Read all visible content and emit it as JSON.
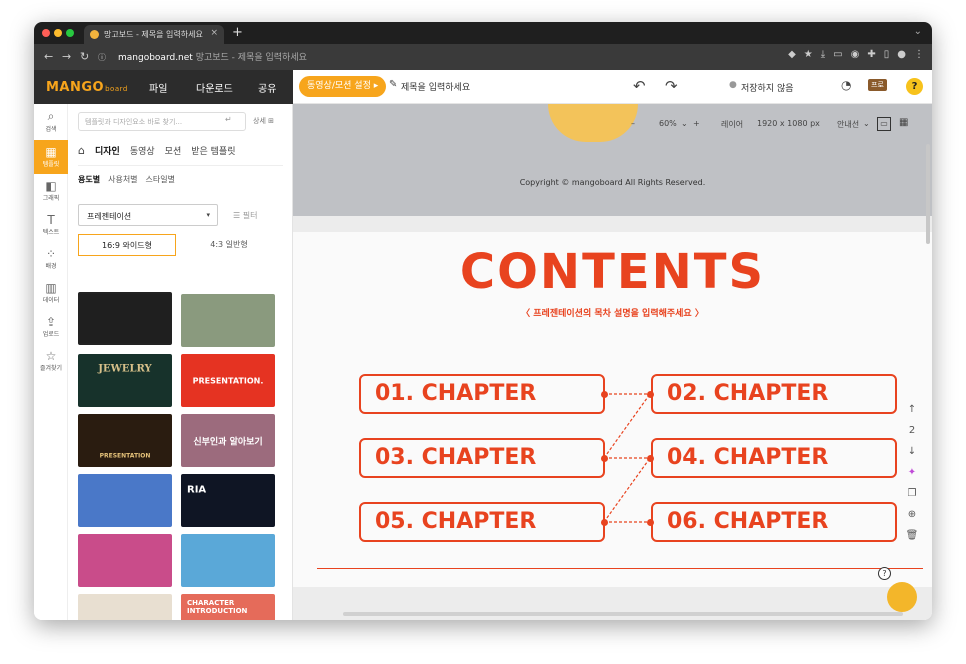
{
  "browser": {
    "tab_title": "망고보드 - 제목을 입력하세요",
    "tab_close": "×",
    "new_tab": "+",
    "url_host": "mangoboard.net",
    "url_rest": "망고보드 - 제목을 입력하세요",
    "back": "←",
    "forward": "→",
    "reload": "↻"
  },
  "appbar": {
    "logo": "MANGO",
    "logo_suffix": "board",
    "menu": [
      "파일",
      "다운로드",
      "공유"
    ],
    "motion_button": "동영상/모션 설정 ▸",
    "title_placeholder": "제목을 입력하세요",
    "undo": "↶",
    "redo": "↷",
    "save_status": "저장하지 않음",
    "pro_badge": "프로",
    "help": "?"
  },
  "rail": {
    "items": [
      {
        "label": "검색",
        "icon": "search-icon",
        "glyph": "⌕"
      },
      {
        "label": "템플릿",
        "icon": "template-icon",
        "glyph": "▦"
      },
      {
        "label": "그래픽",
        "icon": "graphic-icon",
        "glyph": "◧"
      },
      {
        "label": "텍스트",
        "icon": "text-icon",
        "glyph": "T"
      },
      {
        "label": "배경",
        "icon": "background-icon",
        "glyph": "⁘"
      },
      {
        "label": "데이터",
        "icon": "chart-icon",
        "glyph": "▥"
      },
      {
        "label": "업로드",
        "icon": "upload-icon",
        "glyph": "⇪"
      },
      {
        "label": "즐겨찾기",
        "icon": "star-icon",
        "glyph": "☆"
      }
    ]
  },
  "panel": {
    "search_placeholder": "템플릿과 디자인요소 바로 찾기...",
    "search_button": "↵",
    "detail_label": "상세",
    "tabs": [
      "디자인",
      "동영상",
      "모션",
      "받은 템플릿"
    ],
    "subtabs": [
      "용도별",
      "사용처별",
      "스타일별"
    ],
    "category_select": "프레젠테이션",
    "caret": "▾",
    "filter_label": "필터",
    "ratio_wide": "16:9 와이드형",
    "ratio_normal": "4:3 일반형",
    "thumbnails": [
      {
        "text": "",
        "bg": "#1f1f1f"
      },
      {
        "text": "",
        "bg": "#8a9a7e"
      },
      {
        "text": "JEWELRY",
        "bg": "#17322b"
      },
      {
        "text": "PRESENTATION.",
        "bg": "#e53322"
      },
      {
        "text": "PRESENTATION",
        "bg": "#2a1c10"
      },
      {
        "text": "신부인과 알아보기",
        "bg": "#9c6b7d"
      },
      {
        "text": "",
        "bg": "#4a78c8"
      },
      {
        "text": "RIA",
        "bg": "#0f1524"
      },
      {
        "text": "",
        "bg": "#c94c8a"
      },
      {
        "text": "",
        "bg": "#5aa8d8"
      },
      {
        "text": "",
        "bg": "#e8dfd1"
      },
      {
        "text": "CHARACTER INTRODUCTION",
        "bg": "#e56b5a"
      }
    ]
  },
  "canvas": {
    "zoom_minus": "–",
    "zoom_value": "60%",
    "zoom_plus": "+",
    "layer_label": "레이어",
    "size_label": "1920 x 1080 px",
    "guide_label": "안내선",
    "copyright": "Copyright © mangoboard All Rights Reserved.",
    "slide_title": "CONTENTS",
    "slide_subtitle": "〈 프레젠테이션의 목차 설명을 입력해주세요 〉",
    "chapters": [
      "01. CHAPTER",
      "02. CHAPTER",
      "03. CHAPTER",
      "04. CHAPTER",
      "05. CHAPTER",
      "06. CHAPTER"
    ],
    "page_up": "↑",
    "page_number": "2",
    "page_down": "↓",
    "collapse_left": "‹",
    "expand_right": "›",
    "help": "?",
    "accent": "#e8431f"
  }
}
